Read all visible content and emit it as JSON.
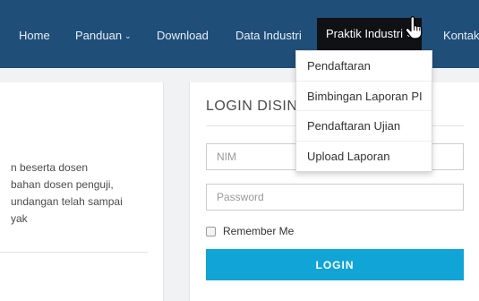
{
  "nav": {
    "items": [
      {
        "label": "Home"
      },
      {
        "label": "Panduan",
        "caret": "⌄"
      },
      {
        "label": "Download"
      },
      {
        "label": "Data Industri"
      },
      {
        "label": "Praktik Industri",
        "caret": "⌄"
      },
      {
        "label": "Kontak"
      }
    ],
    "dropdown": [
      {
        "label": "Pendaftaran"
      },
      {
        "label": "Bimbingan Laporan PI"
      },
      {
        "label": "Pendaftaran Ujian"
      },
      {
        "label": "Upload Laporan"
      }
    ]
  },
  "left_panel": {
    "lines": [
      "n beserta dosen",
      "bahan dosen penguji,",
      "undangan telah sampai",
      "yak"
    ]
  },
  "login": {
    "title": "LOGIN DISIN",
    "nim_placeholder": "NIM",
    "password_placeholder": "Password",
    "remember_label": "Remember Me",
    "button_label": "LOGIN"
  },
  "colors": {
    "navbar": "#1f4e79",
    "active_nav": "#0f1115",
    "login_button": "#11a4d6"
  },
  "icons": {
    "dropdown_caret": "chevron-down-icon",
    "pointer": "hand-pointer-icon"
  }
}
